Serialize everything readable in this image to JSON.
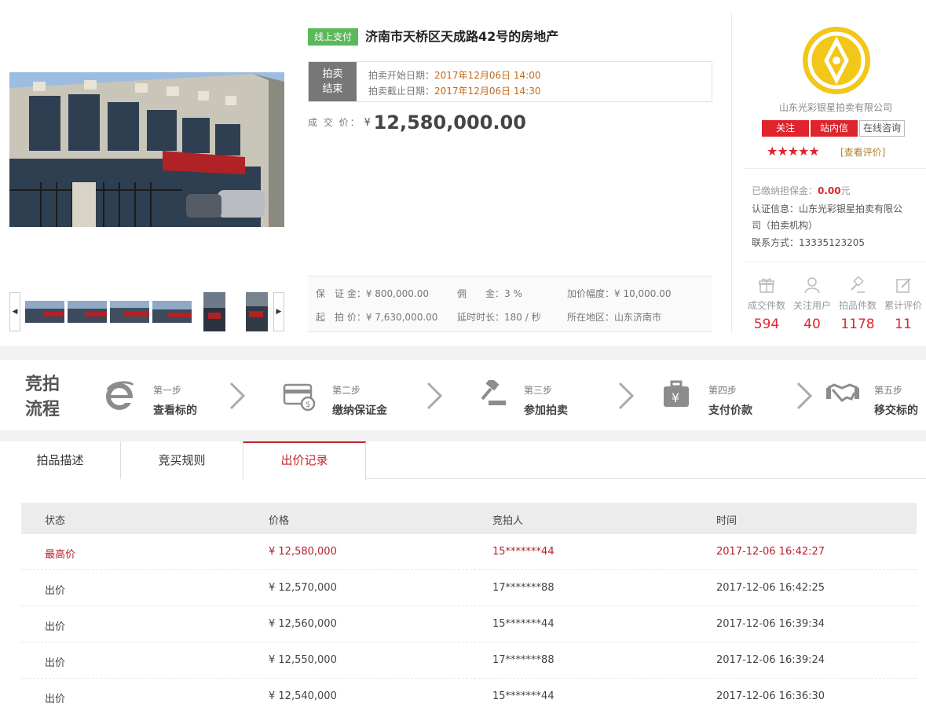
{
  "item": {
    "pay_tag": "线上支付",
    "title": "济南市天桥区天成路42号的房地产",
    "status": [
      "拍卖",
      "结束"
    ],
    "start_label": "拍卖开始日期：",
    "start_value": "2017年12月06日 14:00",
    "end_label": "拍卖截止日期：",
    "end_value": "2017年12月06日 14:30",
    "deal_label": "成 交 价：",
    "deal_currency": "¥",
    "deal_price": "12,580,000.00"
  },
  "fees": {
    "deposit": "保　证 金：¥ 800,000.00",
    "commission": "佣　　金：3 %",
    "increment": "加价幅度：¥ 10,000.00",
    "start_price": "起　拍 价：¥ 7,630,000.00",
    "delay": "延时时长：180 / 秒",
    "region": "所在地区：山东济南市"
  },
  "seller": {
    "name": "山东光彩银星拍卖有限公司",
    "follow": "关注",
    "message": "站内信",
    "consult": "在线咨询",
    "stars": "★★★★★",
    "review_link": "[查看评价]",
    "deposit_label": "已缴纳担保金：",
    "deposit_value": "0.00",
    "deposit_unit": "元",
    "cert_line1": "认证信息：山东光彩银星拍卖有限公",
    "cert_line2": "司（拍卖机构）",
    "contact": "联系方式：13335123205",
    "stats": [
      {
        "label": "成交件数",
        "value": "594"
      },
      {
        "label": "关注用户",
        "value": "40"
      },
      {
        "label": "拍品件数",
        "value": "1178"
      },
      {
        "label": "累计评价",
        "value": "11"
      }
    ]
  },
  "process": {
    "title_line1": "竞拍",
    "title_line2": "流程",
    "steps": [
      {
        "no": "第一步",
        "name": "查看标的"
      },
      {
        "no": "第二步",
        "name": "缴纳保证金"
      },
      {
        "no": "第三步",
        "name": "参加拍卖"
      },
      {
        "no": "第四步",
        "name": "支付价款"
      },
      {
        "no": "第五步",
        "name": "移交标的"
      }
    ]
  },
  "tabs": [
    {
      "label": "拍品描述"
    },
    {
      "label": "竞买规则"
    },
    {
      "label": "出价记录"
    }
  ],
  "bids": {
    "headers": [
      "状态",
      "价格",
      "竞拍人",
      "时间"
    ],
    "rows": [
      {
        "status": "最高价",
        "price": "¥ 12,580,000",
        "bidder": "15*******44",
        "time": "2017-12-06 16:42:27"
      },
      {
        "status": "出价",
        "price": "¥ 12,570,000",
        "bidder": "17*******88",
        "time": "2017-12-06 16:42:25"
      },
      {
        "status": "出价",
        "price": "¥ 12,560,000",
        "bidder": "15*******44",
        "time": "2017-12-06 16:39:34"
      },
      {
        "status": "出价",
        "price": "¥ 12,550,000",
        "bidder": "17*******88",
        "time": "2017-12-06 16:39:24"
      },
      {
        "status": "出价",
        "price": "¥ 12,540,000",
        "bidder": "15*******44",
        "time": "2017-12-06 16:36:30"
      }
    ]
  },
  "colors": {
    "accent_red": "#e0242d",
    "tag_green": "#5cb85c",
    "active_tab": "#c1272d"
  }
}
